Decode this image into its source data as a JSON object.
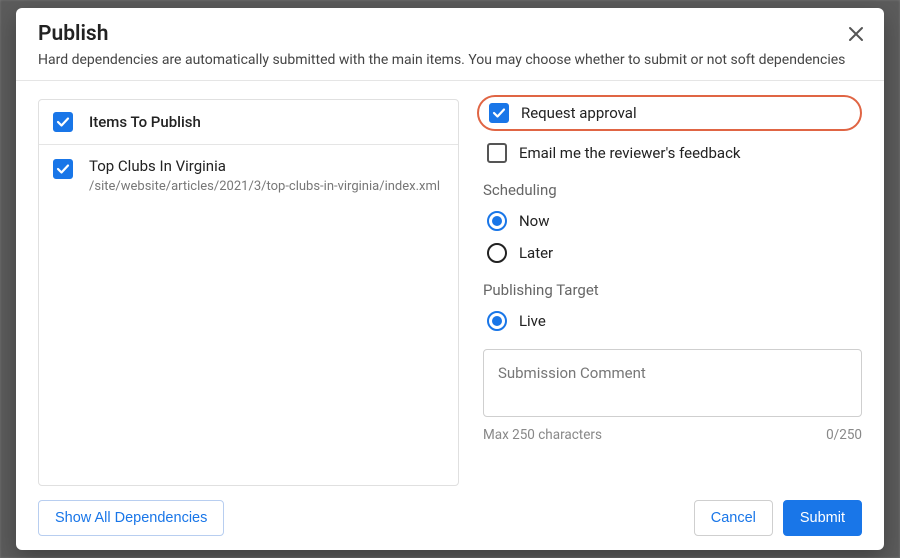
{
  "dialog": {
    "title": "Publish",
    "subtitle": "Hard dependencies are automatically submitted with the main items. You may choose whether to submit or not soft dependencies"
  },
  "items": {
    "header_label": "Items To Publish",
    "rows": [
      {
        "title": "Top Clubs In Virginia",
        "path": "/site/website/articles/2021/3/top-clubs-in-virginia/index.xml"
      }
    ]
  },
  "options": {
    "request_approval_label": "Request approval",
    "email_feedback_label": "Email me the reviewer's feedback",
    "scheduling_label": "Scheduling",
    "scheduling_now": "Now",
    "scheduling_later": "Later",
    "publishing_target_label": "Publishing Target",
    "publishing_target_live": "Live",
    "comment_placeholder": "Submission Comment",
    "char_hint": "Max 250 characters",
    "char_count": "0/250"
  },
  "footer": {
    "show_all": "Show All Dependencies",
    "cancel": "Cancel",
    "submit": "Submit"
  }
}
